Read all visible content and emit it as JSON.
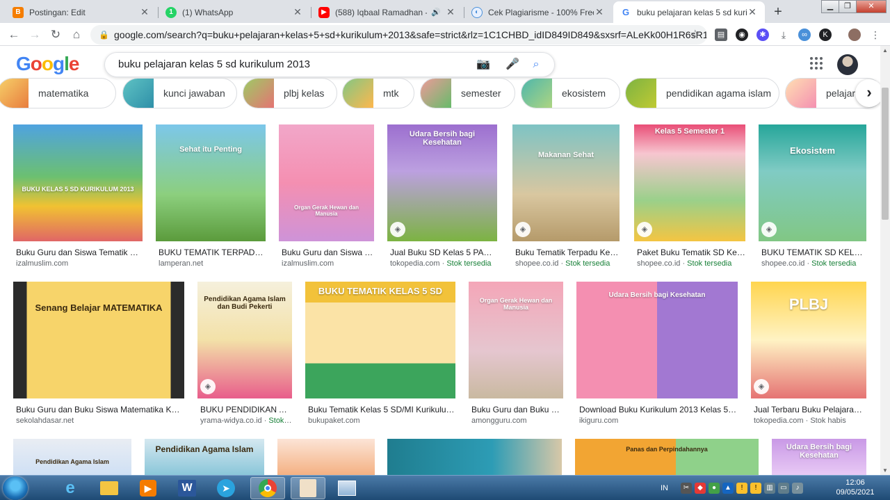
{
  "browser": {
    "tabs": [
      {
        "title": "Postingan: Edit",
        "icon": "blogger-icon",
        "color": "#f57d00"
      },
      {
        "title": "(1) WhatsApp",
        "icon": "whatsapp-icon",
        "color": "#25d366"
      },
      {
        "title": "(588) Iqbaal Ramadhan - Ri",
        "icon": "youtube-icon",
        "color": "#ff0000"
      },
      {
        "title": "Cek Plagiarisme - 100% Free Pla",
        "icon": "plagiarism-icon",
        "color": "#4a90d9"
      },
      {
        "title": "buku pelajaran kelas 5 sd kuriku",
        "icon": "google-icon",
        "color": "#4285f4"
      }
    ],
    "new_tab": "+",
    "url": "google.com/search?q=buku+pelajaran+kelas+5+sd+kurikulum+2013&safe=strict&rlz=1C1CHBD_idID849ID849&sxsrf=ALeKk00H1R6sR12..."
  },
  "google": {
    "logo": "Google",
    "query": "buku pelajaran kelas 5 sd kurikulum 2013"
  },
  "chips": [
    {
      "label": "matematika"
    },
    {
      "label": "kunci jawaban"
    },
    {
      "label": "plbj kelas"
    },
    {
      "label": "mtk"
    },
    {
      "label": "semester"
    },
    {
      "label": "ekosistem"
    },
    {
      "label": "pendidikan agama islam"
    },
    {
      "label": "pelajaran"
    }
  ],
  "results": [
    {
      "caption": "Buku Guru dan Siswa Tematik Ke...",
      "source": "izalmuslim.com",
      "stock": "",
      "book_text": "BUKU KELAS 5 SD KURIKULUM 2013"
    },
    {
      "caption": "BUKU TEMATIK TERPADU K...",
      "source": "lamperan.net",
      "stock": "",
      "book_text": "Sehat itu Penting"
    },
    {
      "caption": "Buku Guru dan Siswa T...",
      "source": "izalmuslim.com",
      "stock": "",
      "book_text": "Organ Gerak Hewan dan Manusia"
    },
    {
      "caption": "Jual Buku SD Kelas 5 PAKE...",
      "source": "tokopedia.com",
      "stock": "Stok tersedia",
      "book_text": "Udara Bersih bagi Kesehatan"
    },
    {
      "caption": "Buku Tematik Terpadu Kela...",
      "source": "shopee.co.id",
      "stock": "Stok tersedia",
      "book_text": "Makanan Sehat"
    },
    {
      "caption": "Paket Buku Tematik SD Kel...",
      "source": "shopee.co.id",
      "stock": "Stok tersedia",
      "book_text": "Kelas 5 Semester 1"
    },
    {
      "caption": "BUKU TEMATIK SD KELAS ...",
      "source": "shopee.co.id",
      "stock": "Stok tersedia",
      "book_text": "Ekosistem"
    },
    {
      "caption": "Buku Guru dan Buku Siswa Matematika Kela...",
      "source": "sekolahdasar.net",
      "stock": "",
      "book_text": "Senang Belajar MATEMATIKA"
    },
    {
      "caption": "BUKU PENDIDIKAN AG...",
      "source": "yrama-widya.co.id",
      "stock": "Stok ...",
      "book_text": "Pendidikan Agama Islam dan Budi Pekerti"
    },
    {
      "caption": "Buku Tematik Kelas 5 SD/MI Kurikulum...",
      "source": "bukupaket.com",
      "stock": "",
      "book_text": "BUKU TEMATIK KELAS 5 SD"
    },
    {
      "caption": "Buku Guru dan Buku Si...",
      "source": "amongguru.com",
      "stock": "",
      "book_text": "Organ Gerak Hewan dan Manusia"
    },
    {
      "caption": "Download Buku Kurikulum 2013 Kelas 5 R...",
      "source": "ikiguru.com",
      "stock": "",
      "book_text": "Udara Bersih bagi Kesehatan"
    },
    {
      "caption": "Jual Terbaru Buku Pelajaran ...",
      "source": "tokopedia.com",
      "stock": "Stok habis",
      "book_text": "PLBJ"
    },
    {
      "caption": "",
      "source": "",
      "stock": "",
      "book_text": "Pendidikan Agama Islam"
    },
    {
      "caption": "",
      "source": "",
      "stock": "",
      "book_text": "Pendidikan Agama Islam"
    },
    {
      "caption": "",
      "source": "",
      "stock": "",
      "book_text": ""
    },
    {
      "caption": "",
      "source": "",
      "stock": "",
      "book_text": ""
    },
    {
      "caption": "",
      "source": "",
      "stock": "",
      "book_text": "Panas dan Perpindahannya"
    },
    {
      "caption": "",
      "source": "",
      "stock": "",
      "book_text": "Udara Bersih bagi Kesehatan"
    }
  ],
  "taskbar": {
    "language": "IN",
    "time": "12:06",
    "date": "09/05/2021"
  }
}
